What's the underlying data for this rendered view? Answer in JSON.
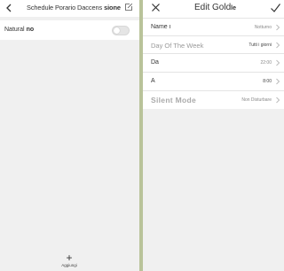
{
  "left": {
    "header": {
      "title": "Schedule Porario Daccens",
      "title_bold": "sione",
      "back_icon": "chevron-left-icon",
      "edit_icon": "edit-icon"
    },
    "natural_row": {
      "label": "Natural",
      "value": "no",
      "enabled": false
    },
    "add_button": {
      "symbol": "+",
      "label": "Aggiungi"
    }
  },
  "right": {
    "header": {
      "title": "Edit Gold",
      "title_suffix": "le",
      "close_icon": "close-icon",
      "confirm_icon": "checkmark-icon"
    },
    "rows": [
      {
        "label": "Name ı",
        "value": "Notturno"
      },
      {
        "label": "Day Of The Week",
        "value": "Tutti i giorni"
      },
      {
        "label": "Da",
        "value": "22:00"
      },
      {
        "label": "A",
        "value": "8:00"
      },
      {
        "label": "Silent Mode",
        "value": "Non Disturbare"
      }
    ]
  },
  "colors": {
    "divider": "#b9c39a",
    "background": "#f0f0f0",
    "surface": "#ffffff"
  }
}
